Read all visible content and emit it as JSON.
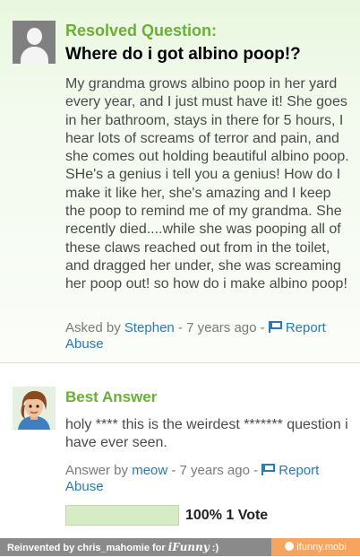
{
  "question": {
    "heading": "Resolved Question:",
    "title": "Where do i got albino poop!?",
    "body": "My grandma grows albino poop in her yard every year, and I just must have it! She goes in her bathroom, stays in there for 5 hours, I hear lots of screams of terror and pain, and she comes out holding beautiful albino poop. SHe's a genius i tell you a genius! How do I make it like her, she's amazing and I keep the poop to remind me of my grandma. She recently died....while she was pooping all of these claws reached out from in the toilet, and dragged her under, she was screaming her poop out! so how do i make albino poop!",
    "asked_prefix": "Asked by ",
    "author": "Stephen",
    "time": " - 7 years ago - ",
    "report_label": "Report Abuse"
  },
  "answer": {
    "heading": "Best Answer",
    "body": "holy **** this is the weirdest ******* question i have ever seen.",
    "answer_prefix": "Answer by ",
    "author": "meow",
    "time": " - 7 years ago - ",
    "report_label": "Report Abuse",
    "vote_percent": 100,
    "vote_text": "100% 1 Vote"
  },
  "footer": {
    "reinvented_text": "Reinvented by chris_mahomie for ",
    "brand": "iFunny",
    "smiley": " :)",
    "site": "ifunny.mobi"
  },
  "colors": {
    "accent_green": "#6ab034",
    "link_blue": "#2a7ab3",
    "footer_gray": "#8a8a8a",
    "footer_orange": "#f7a45f"
  }
}
